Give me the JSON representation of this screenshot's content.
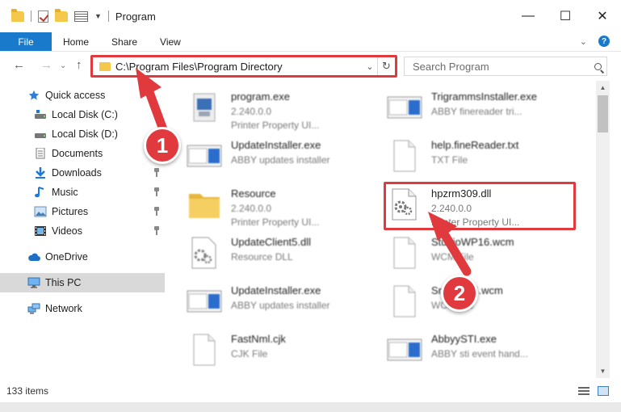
{
  "window": {
    "title": "Program",
    "minimize": "—",
    "maximize": "☐",
    "close": "✕"
  },
  "ribbon": {
    "tabs": [
      "File",
      "Home",
      "Share",
      "View"
    ]
  },
  "address": {
    "path": "C:\\Program Files\\Program Directory",
    "search_placeholder": "Search Program"
  },
  "sidebar": {
    "items": [
      {
        "label": "Quick access",
        "icon": "star-icon",
        "pinned": false
      },
      {
        "label": "Local Disk (C:)",
        "icon": "drive-icon",
        "pinned": true
      },
      {
        "label": "Local Disk (D:)",
        "icon": "drive-icon",
        "pinned": false
      },
      {
        "label": "Documents",
        "icon": "documents-icon",
        "pinned": false
      },
      {
        "label": "Downloads",
        "icon": "download-icon",
        "pinned": true
      },
      {
        "label": "Music",
        "icon": "music-icon",
        "pinned": true
      },
      {
        "label": "Pictures",
        "icon": "pictures-icon",
        "pinned": true
      },
      {
        "label": "Videos",
        "icon": "videos-icon",
        "pinned": true
      },
      {
        "label": "OneDrive",
        "icon": "cloud-icon",
        "pinned": false
      },
      {
        "label": "This PC",
        "icon": "computer-icon",
        "pinned": false,
        "selected": true
      },
      {
        "label": "Network",
        "icon": "network-icon",
        "pinned": false
      }
    ]
  },
  "files": [
    {
      "name": "program.exe",
      "line1": "2.240.0.0",
      "line2": "Printer Property UI...",
      "icon": "exe-icon"
    },
    {
      "name": "TrigrammsInstaller.exe",
      "line1": "ABBY finereader tri...",
      "line2": "",
      "icon": "installer-icon"
    },
    {
      "name": "UpdateInstaller.exe",
      "line1": "ABBY updates installer",
      "line2": "",
      "icon": "installer-icon"
    },
    {
      "name": "help.fineReader.txt",
      "line1": "TXT File",
      "line2": "",
      "icon": "text-file-icon"
    },
    {
      "name": "Resource",
      "line1": "2.240.0.0",
      "line2": "Printer Property UI...",
      "icon": "folder-icon"
    },
    {
      "name": "hpzrm309.dll",
      "line1": "2.240.0.0",
      "line2": "Printer Property UI...",
      "icon": "dll-icon"
    },
    {
      "name": "UpdateClient5.dll",
      "line1": "Resource DLL",
      "line2": "",
      "icon": "dll-icon"
    },
    {
      "name": "StudioWP16.wcm",
      "line1": "WCM File",
      "line2": "",
      "icon": "blank-file-icon"
    },
    {
      "name": "UpdateInstaller.exe",
      "line1": "ABBY updates installer",
      "line2": "",
      "icon": "installer-icon"
    },
    {
      "name": "SndFile14.wcm",
      "line1": "WCM File",
      "line2": "",
      "icon": "blank-file-icon"
    },
    {
      "name": "FastNml.cjk",
      "line1": "CJK File",
      "line2": "",
      "icon": "blank-file-icon"
    },
    {
      "name": "AbbyySTI.exe",
      "line1": "ABBY sti event hand...",
      "line2": "",
      "icon": "installer-icon"
    }
  ],
  "status": {
    "item_count": "133 items"
  },
  "annotations": {
    "step1": "1",
    "step2": "2"
  }
}
